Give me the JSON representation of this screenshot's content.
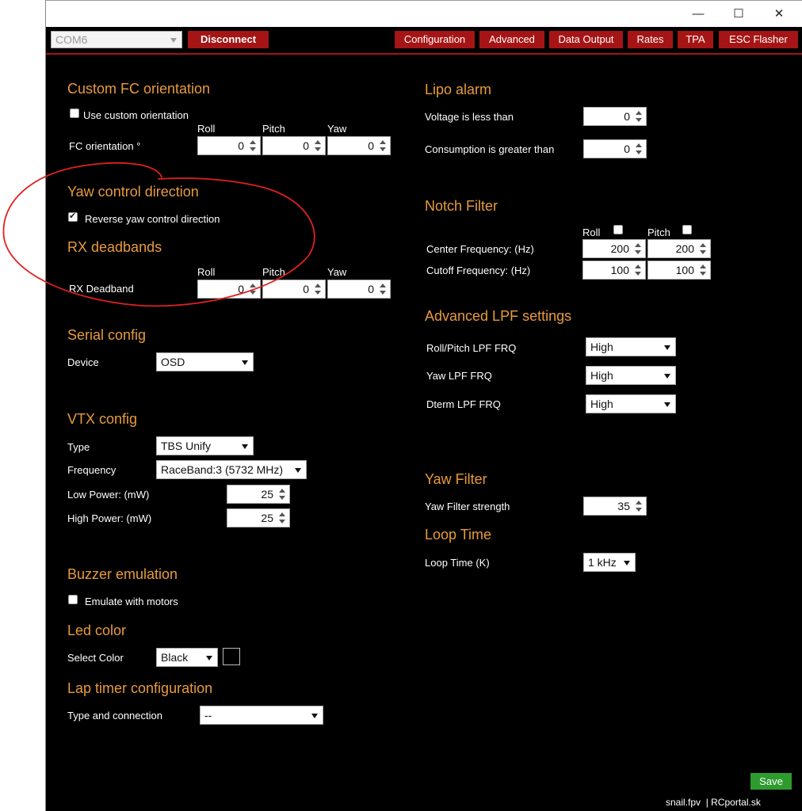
{
  "titlebar": {
    "minimize": "—",
    "maximize": "☐",
    "close": "✕"
  },
  "port": {
    "value": "COM6",
    "disconnect": "Disconnect"
  },
  "nav": [
    "Configuration",
    "Advanced",
    "Data Output",
    "Rates",
    "TPA",
    "ESC Flasher"
  ],
  "fc_orientation": {
    "title": "Custom FC orientation",
    "use_custom": "Use custom orientation",
    "use_custom_checked": false,
    "col_roll": "Roll",
    "col_pitch": "Pitch",
    "col_yaw": "Yaw",
    "label": "FC orientation °",
    "roll": "0",
    "pitch": "0",
    "yaw": "0"
  },
  "yaw_control": {
    "title": "Yaw control direction",
    "reverse": "Reverse yaw control direction",
    "reverse_checked": true
  },
  "rx_deadbands": {
    "title": "RX deadbands",
    "col_roll": "Roll",
    "col_pitch": "Pitch",
    "col_yaw": "Yaw",
    "label": "RX Deadband",
    "roll": "0",
    "pitch": "0",
    "yaw": "0"
  },
  "serial": {
    "title": "Serial config",
    "device_label": "Device",
    "device": "OSD"
  },
  "vtx": {
    "title": "VTX config",
    "type_label": "Type",
    "type": "TBS Unify",
    "freq_label": "Frequency",
    "freq": "RaceBand:3 (5732 MHz)",
    "low_label": "Low Power: (mW)",
    "low": "25",
    "high_label": "High Power: (mW)",
    "high": "25"
  },
  "buzzer": {
    "title": "Buzzer emulation",
    "emulate": "Emulate with motors",
    "emulate_checked": false
  },
  "led": {
    "title": "Led color",
    "label": "Select Color",
    "value": "Black",
    "swatch": "#000000"
  },
  "lap_timer": {
    "title": "Lap timer configuration",
    "label": "Type and connection",
    "value": "--"
  },
  "lipo": {
    "title": "Lipo alarm",
    "voltage_label": "Voltage is less than",
    "voltage": "0",
    "consumption_label": "Consumption is greater than",
    "consumption": "0"
  },
  "notch": {
    "title": "Notch Filter",
    "col_roll": "Roll",
    "col_pitch": "Pitch",
    "roll_checked": false,
    "pitch_checked": false,
    "center_label": "Center Frequency: (Hz)",
    "center_roll": "200",
    "center_pitch": "200",
    "cutoff_label": "Cutoff Frequency: (Hz)",
    "cutoff_roll": "100",
    "cutoff_pitch": "100"
  },
  "lpf": {
    "title": "Advanced LPF settings",
    "rp_label": "Roll/Pitch LPF FRQ",
    "rp": "High",
    "yaw_label": "Yaw LPF FRQ",
    "yaw": "High",
    "dterm_label": "Dterm LPF FRQ",
    "dterm": "High"
  },
  "yaw_filter": {
    "title": "Yaw Filter",
    "label": "Yaw Filter strength",
    "value": "35"
  },
  "loop_time": {
    "title": "Loop Time",
    "label": "Loop Time (K)",
    "value": "1 kHz"
  },
  "save": "Save",
  "watermark": "snail.fpv  | RCportal.sk",
  "colors": {
    "accent": "#e89b3c",
    "nav_bg": "#a51515",
    "save_bg": "#2e9b2e",
    "annotation": "#e02020"
  }
}
